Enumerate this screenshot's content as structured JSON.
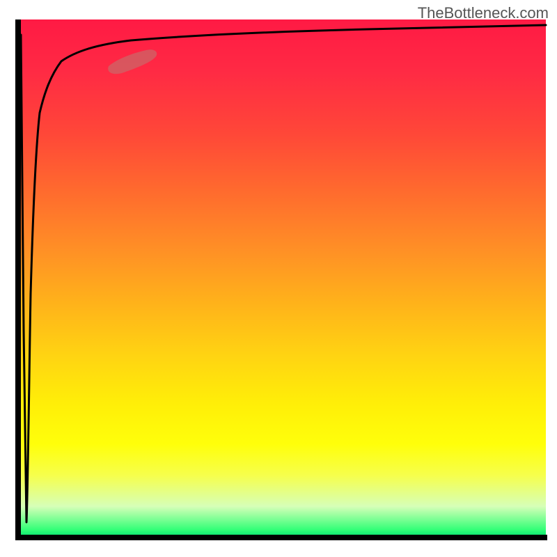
{
  "watermark": "TheBottleneck.com",
  "chart_data": {
    "type": "line",
    "title": "",
    "xlabel": "",
    "ylabel": "",
    "xlim": [
      0,
      100
    ],
    "ylim": [
      0,
      100
    ],
    "series": [
      {
        "name": "curve",
        "x": [
          0.3,
          0.8,
          1.3,
          2.0,
          2.8,
          3.8,
          4.8,
          6.0,
          8.0,
          10.5,
          13.5,
          17.0,
          21.0,
          28.0,
          38.0,
          52.0,
          70.0,
          88.0,
          100.0
        ],
        "values": [
          97.0,
          40.0,
          3.0,
          47.0,
          66.0,
          76.0,
          81.5,
          85.0,
          88.0,
          89.5,
          90.5,
          91.5,
          92.2,
          93.2,
          94.2,
          95.2,
          96.2,
          97.3,
          98.0
        ]
      }
    ],
    "highlight_segment": {
      "x_start": 17.0,
      "x_end": 25.0
    },
    "background_gradient": {
      "top_color": "#ff1a44",
      "mid_color": "#ffff0a",
      "bottom_color": "#00e070"
    }
  }
}
